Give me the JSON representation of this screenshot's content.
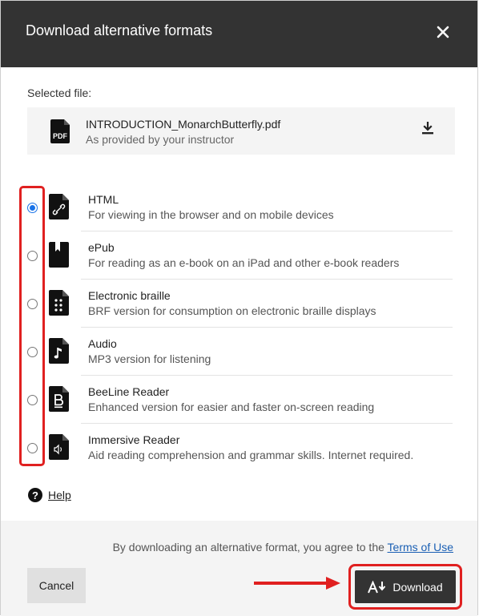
{
  "dialog": {
    "title": "Download alternative formats",
    "close_icon": "close-icon"
  },
  "selected_file": {
    "label": "Selected file:",
    "name": "INTRODUCTION_MonarchButterfly.pdf",
    "source": "As provided by your instructor",
    "file_icon": "pdf-icon",
    "download_icon": "download-icon"
  },
  "options": [
    {
      "label": "HTML",
      "description": "For viewing in the browser and on mobile devices",
      "icon": "html-file-icon",
      "selected": true
    },
    {
      "label": "ePub",
      "description": "For reading as an e-book on an iPad and other e-book readers",
      "icon": "epub-file-icon",
      "selected": false
    },
    {
      "label": "Electronic braille",
      "description": "BRF version for consumption on electronic braille displays",
      "icon": "braille-file-icon",
      "selected": false
    },
    {
      "label": "Audio",
      "description": "MP3 version for listening",
      "icon": "audio-file-icon",
      "selected": false
    },
    {
      "label": "BeeLine Reader",
      "description": "Enhanced version for easier and faster on-screen reading",
      "icon": "beeline-file-icon",
      "selected": false
    },
    {
      "label": "Immersive Reader",
      "description": "Aid reading comprehension and grammar skills. Internet required.",
      "icon": "immersive-reader-file-icon",
      "selected": false
    }
  ],
  "help": {
    "label": "Help",
    "icon": "help-icon"
  },
  "footer": {
    "agreement_text": "By downloading an alternative format, you agree to the ",
    "terms_link": "Terms of Use",
    "cancel_label": "Cancel",
    "download_label": "Download",
    "download_icon": "text-download-icon"
  },
  "colors": {
    "header_bg": "#333333",
    "accent": "#1a73e8",
    "annotation_red": "#e02020",
    "link": "#1a5fb4"
  }
}
